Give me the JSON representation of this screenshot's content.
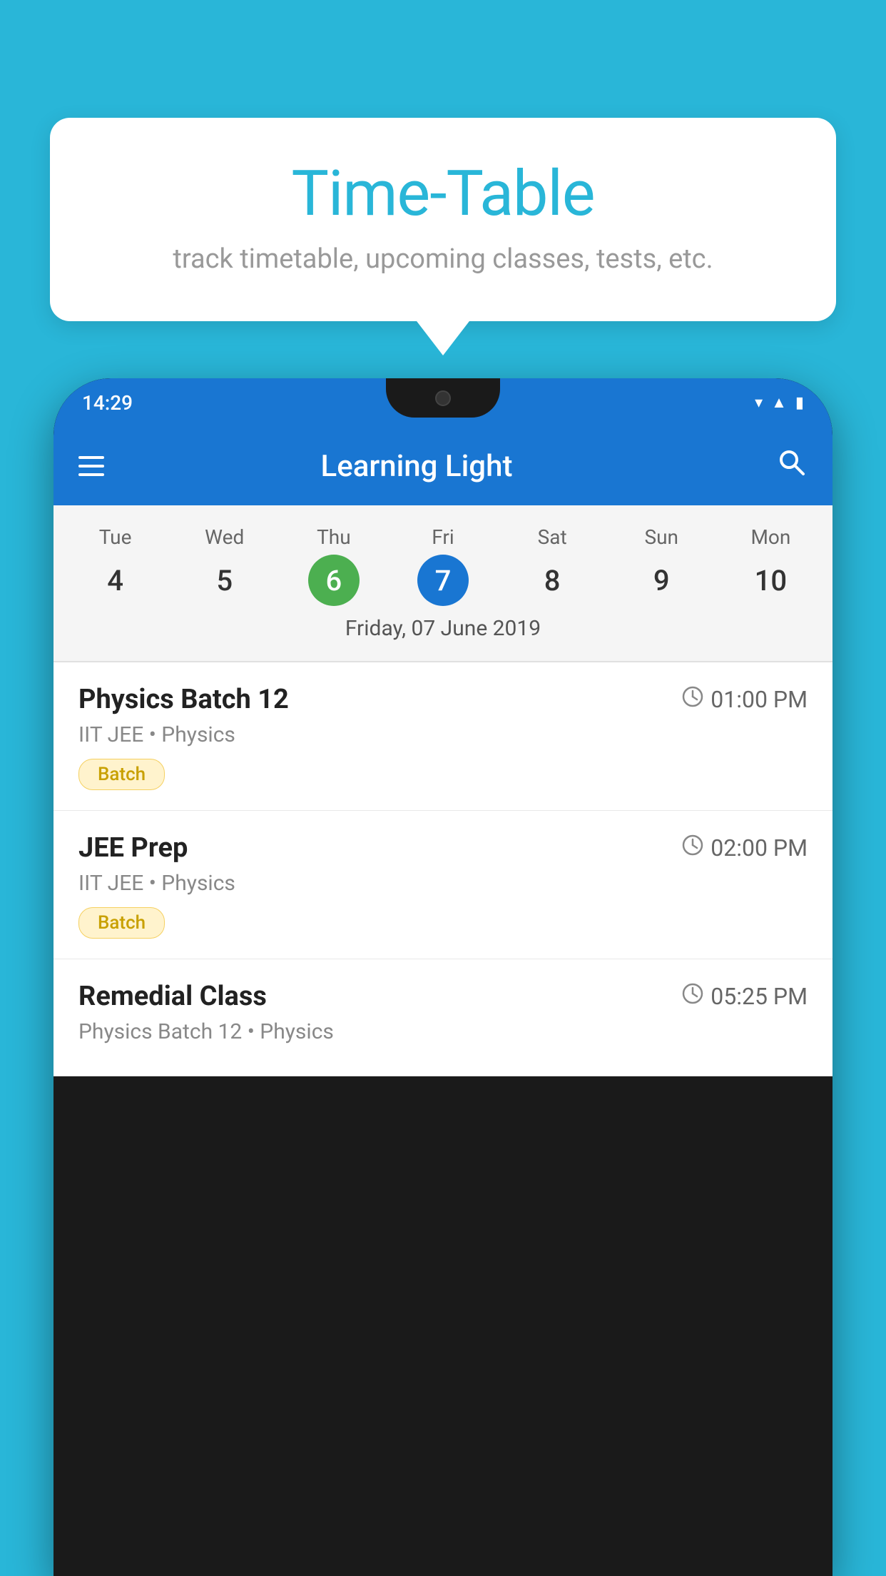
{
  "background_color": "#29b6d8",
  "speech_bubble": {
    "title": "Time-Table",
    "subtitle": "track timetable, upcoming classes, tests, etc."
  },
  "phone": {
    "status_bar": {
      "time": "14:29"
    },
    "app_bar": {
      "title": "Learning Light"
    },
    "calendar": {
      "days": [
        "Tue",
        "Wed",
        "Thu",
        "Fri",
        "Sat",
        "Sun",
        "Mon"
      ],
      "dates": [
        "4",
        "5",
        "6",
        "7",
        "8",
        "9",
        "10"
      ],
      "today_index": 2,
      "selected_index": 3,
      "date_label": "Friday, 07 June 2019"
    },
    "schedule_items": [
      {
        "name": "Physics Batch 12",
        "time": "01:00 PM",
        "sub": "IIT JEE • Physics",
        "badge": "Batch"
      },
      {
        "name": "JEE Prep",
        "time": "02:00 PM",
        "sub": "IIT JEE • Physics",
        "badge": "Batch"
      },
      {
        "name": "Remedial Class",
        "time": "05:25 PM",
        "sub": "Physics Batch 12 • Physics",
        "badge": null
      }
    ]
  }
}
